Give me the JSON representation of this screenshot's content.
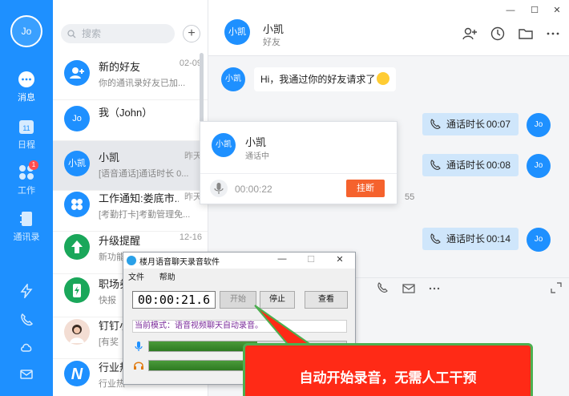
{
  "rail": {
    "avatar": "Jo",
    "items": [
      {
        "label": "消息",
        "icon": "chat-bubble-icon"
      },
      {
        "label": "日程",
        "icon": "calendar-icon",
        "day": "11"
      },
      {
        "label": "工作",
        "icon": "apps-icon",
        "badge": "1"
      },
      {
        "label": "通讯录",
        "icon": "contacts-icon"
      }
    ],
    "bottom_icons": [
      "lightning-icon",
      "phone-sync-icon",
      "cloud-icon",
      "mail-icon"
    ]
  },
  "list": {
    "search_placeholder": "搜索",
    "add": "+",
    "conversations": [
      {
        "name": "新的好友",
        "preview": "你的通讯录好友已加...",
        "time": "02-09",
        "avatar_icon": "add-contact-icon"
      },
      {
        "name": "我（John）",
        "preview": "",
        "time": "",
        "avatar": "Jo"
      },
      {
        "name": "小凯",
        "preview": "[语音通话]通话时长 0...",
        "time": "昨天",
        "avatar": "小凯"
      },
      {
        "name": "工作通知:娄底市...",
        "preview": "[考勤打卡]考勤管理免...",
        "time": "昨天",
        "avatar_icon": "clover-icon"
      },
      {
        "name": "升级提醒",
        "preview": "新功能介绍",
        "time": "12-16",
        "avatar_icon": "upgrade-icon"
      },
      {
        "name": "职场券",
        "preview": "快报",
        "time": "",
        "avatar_icon": "battery-icon"
      },
      {
        "name": "钉钉小",
        "preview": "[有奖",
        "time": "",
        "avatar_icon": "person-photo-icon"
      },
      {
        "name": "行业热",
        "preview": "行业热",
        "time": "",
        "avatar_icon": "n-logo-icon"
      }
    ]
  },
  "chat": {
    "name": "小凯",
    "subtitle": "好友",
    "avatar": "小凯",
    "header_icons": [
      "add-user-icon",
      "clock-icon",
      "folder-icon",
      "more-icon"
    ],
    "window_controls": [
      "minimize-icon",
      "maximize-icon",
      "close-icon"
    ],
    "incoming": "Hi，我通过你的好友请求了",
    "my_avatar": "Jo",
    "calls": [
      {
        "label": "通话时长",
        "duration": "00:07"
      },
      {
        "label": "通话时长",
        "duration": "00:08"
      },
      {
        "label": "通话时长",
        "duration": "00:14"
      }
    ],
    "timestamp_fragment": "55"
  },
  "call_popup": {
    "name": "小凯",
    "status": "通话中",
    "timer": "00:00:22",
    "hangup": "挂断"
  },
  "recorder": {
    "title": "楼月语音聊天录音软件",
    "menu": [
      "文件",
      "帮助"
    ],
    "timer": "00:00:21.6",
    "buttons": {
      "start": "开始",
      "stop": "停止",
      "view": "查看"
    },
    "mode": "当前模式：语音视频聊天自动录音。",
    "mic_level": 0.55,
    "speaker_level": 0.55
  },
  "callout": {
    "text": "自动开始录音，无需人工干预",
    "color": "#ff2a16",
    "border": "#4caf50"
  },
  "colors": {
    "brand": "#1e90ff",
    "hangup": "#f5622d",
    "call_bubble": "#cfe6fb"
  }
}
